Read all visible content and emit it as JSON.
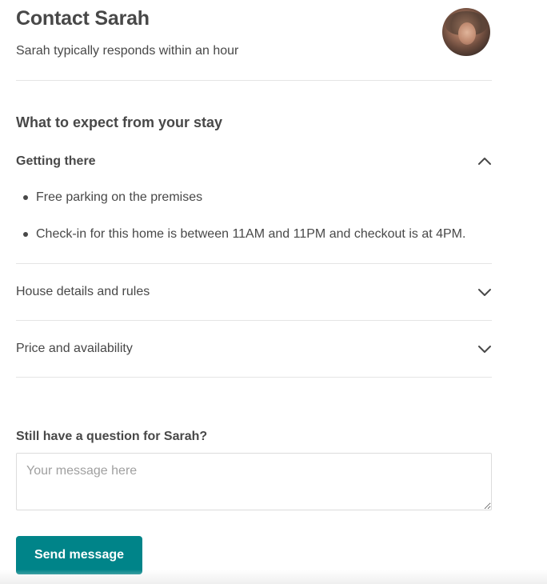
{
  "header": {
    "title": "Contact Sarah",
    "subtitle": "Sarah typically responds within an hour",
    "avatar_icon": "host-avatar"
  },
  "expect": {
    "heading": "What to expect from your stay",
    "sections": [
      {
        "label": "Getting there",
        "expanded": true,
        "icon": "chevron-up-icon",
        "items": [
          "Free parking on the premises",
          "Check-in for this home is between 11AM and 11PM and checkout is at 4PM."
        ]
      },
      {
        "label": "House details and rules",
        "expanded": false,
        "icon": "chevron-down-icon"
      },
      {
        "label": "Price and availability",
        "expanded": false,
        "icon": "chevron-down-icon"
      }
    ]
  },
  "question": {
    "label": "Still have a question for Sarah?",
    "placeholder": "Your message here",
    "value": ""
  },
  "actions": {
    "send_label": "Send message"
  },
  "colors": {
    "accent": "#008489",
    "text": "#484848",
    "divider": "#e4e4e4",
    "placeholder": "#a0a0a0"
  }
}
